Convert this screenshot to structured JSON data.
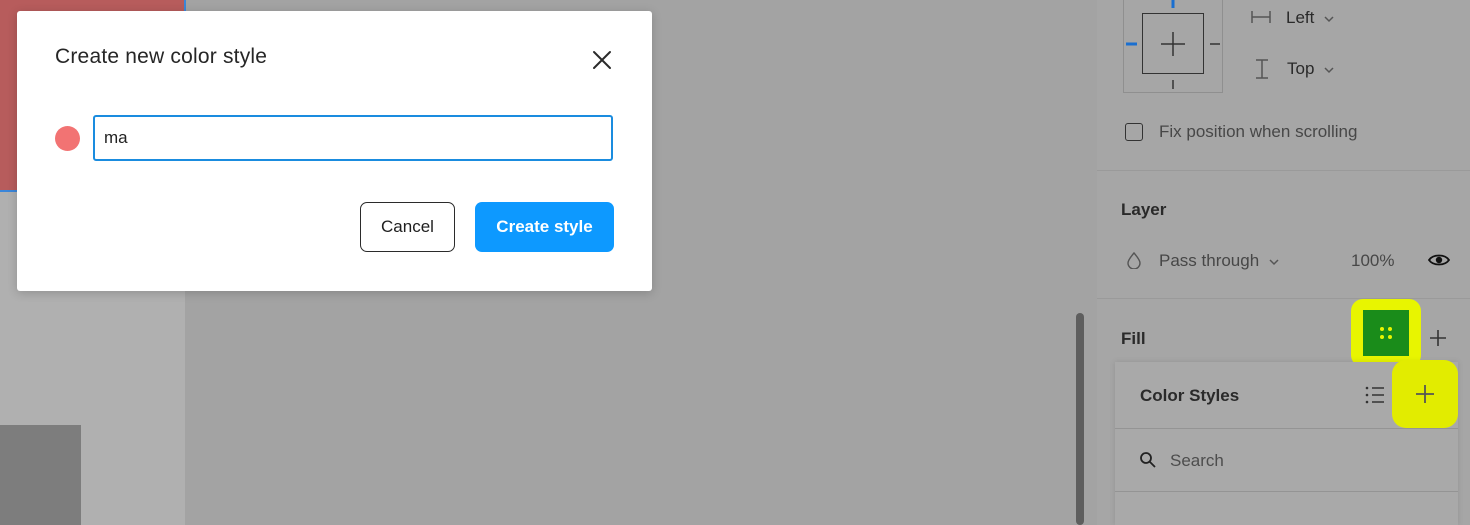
{
  "dialog": {
    "title": "Create new color style",
    "swatch_color": "#f27373",
    "name_value": "ma",
    "cancel_label": "Cancel",
    "create_label": "Create style",
    "close_icon": "close-icon"
  },
  "design_panel": {
    "constraints": {
      "horizontal": "Left",
      "vertical": "Top",
      "fix_position_label": "Fix position when scrolling"
    },
    "layer": {
      "section_title": "Layer",
      "blend_mode": "Pass through",
      "opacity": "100%"
    },
    "fill": {
      "section_title": "Fill"
    },
    "color_styles": {
      "title": "Color Styles",
      "search_placeholder": "Search"
    }
  },
  "colors": {
    "accent_blue": "#0d99ff",
    "highlight_yellow": "#e8f500",
    "fill_green": "#1a8c1a",
    "canvas_red": "#b75c5c"
  }
}
